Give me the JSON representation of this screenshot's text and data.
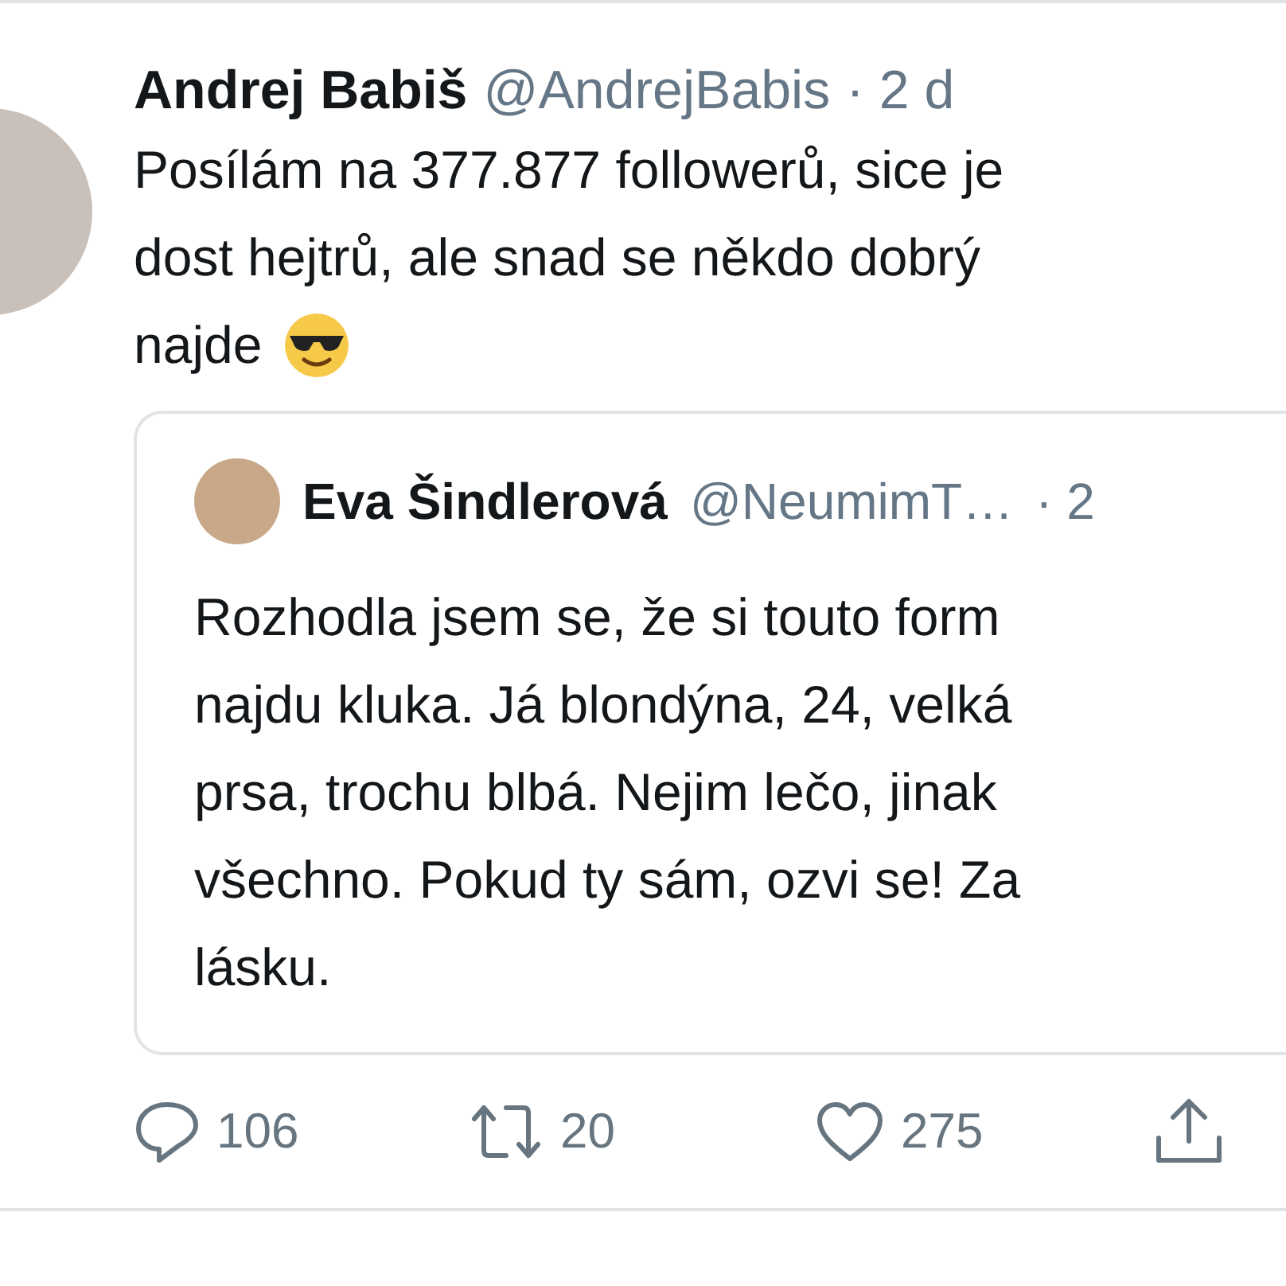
{
  "tweet": {
    "author": {
      "name": "Andrej Babiš",
      "handle": "@AndrejBabis",
      "time": "· 2 d"
    },
    "text_lines": [
      "Posílám na 377.877 followerů, sice je",
      "dost hejtrů, ale snad se někdo dobrý",
      "najde"
    ],
    "quoted": {
      "author": {
        "name": "Eva Šindlerová",
        "handle": "@NeumimT…",
        "time": "· 2"
      },
      "text_lines": [
        "Rozhodla jsem se, že si touto form",
        "najdu kluka. Já blondýna, 24, velká",
        "prsa, trochu blbá. Nejim lečo, jinak",
        "všechno. Pokud ty sám, ozvi se! Za",
        "lásku."
      ]
    },
    "actions": [
      {
        "kind": "reply",
        "count": "106"
      },
      {
        "kind": "retweet",
        "count": "20"
      },
      {
        "kind": "like",
        "count": "275"
      },
      {
        "kind": "share"
      }
    ]
  }
}
